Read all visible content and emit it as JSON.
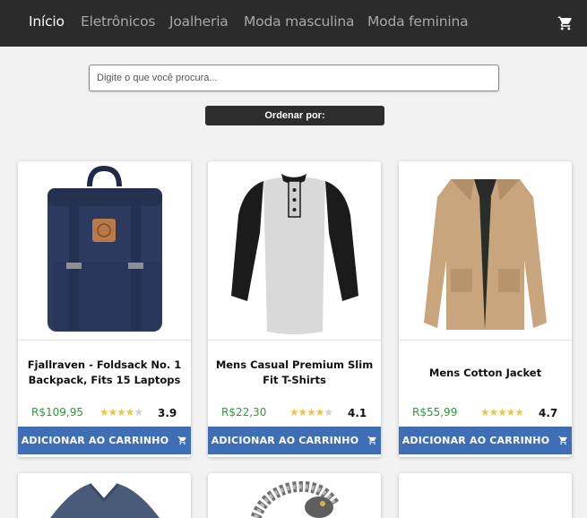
{
  "nav": {
    "items": [
      {
        "label": "Início",
        "active": true
      },
      {
        "label": "Eletrônicos",
        "active": false
      },
      {
        "label": "Joalheria",
        "active": false
      },
      {
        "label": "Moda masculina",
        "active": false
      },
      {
        "label": "Moda feminina",
        "active": false
      }
    ],
    "cart_icon": "shopping-cart-icon"
  },
  "search": {
    "placeholder": "Digite o que você procura...",
    "value": ""
  },
  "sort": {
    "label": "Ordenar por:"
  },
  "products": [
    {
      "title": "Fjallraven - Foldsack No. 1 Backpack, Fits 15 Laptops",
      "price": "R$109,95",
      "rating": "3.9",
      "stars": 3.9,
      "image": "backpack-image",
      "button_label": "ADICIONAR AO CARRINHO"
    },
    {
      "title": "Mens Casual Premium Slim Fit T-Shirts",
      "price": "R$22,30",
      "rating": "4.1",
      "stars": 4.1,
      "image": "tshirt-image",
      "button_label": "ADICIONAR AO CARRINHO"
    },
    {
      "title": "Mens Cotton Jacket",
      "price": "R$55,99",
      "rating": "4.7",
      "stars": 4.7,
      "image": "jacket-image",
      "button_label": "ADICIONAR AO CARRINHO"
    }
  ],
  "partial_products": [
    {
      "image": "sweater-image"
    },
    {
      "image": "bracelet-image"
    },
    {
      "image": "blank-image"
    }
  ],
  "colors": {
    "navbar": "#2b2b2b",
    "button": "#3f6eb5",
    "price": "#2e9a3a",
    "star": "#f0c443"
  }
}
